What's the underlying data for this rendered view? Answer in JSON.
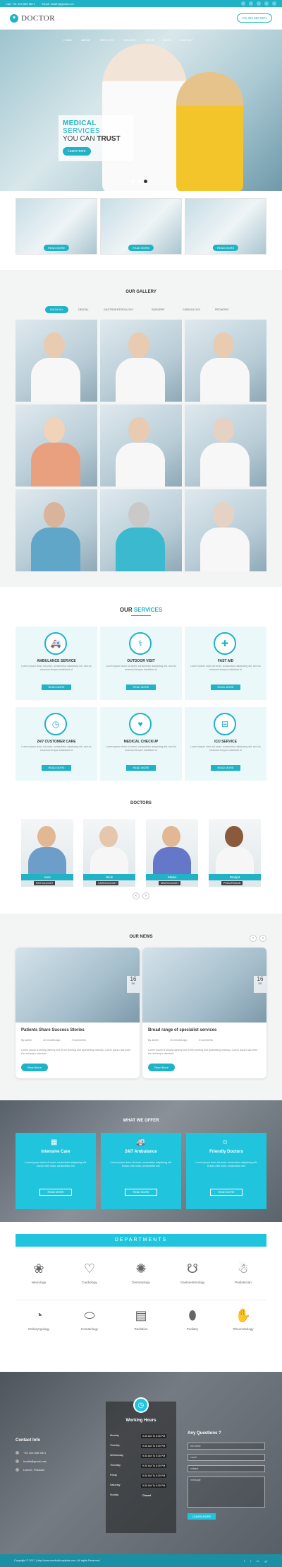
{
  "topbar": {
    "phone": "Call: +91 324 555 9871",
    "email": "Email: health@gmail.com",
    "social": [
      "f",
      "t",
      "in",
      "g+",
      "p"
    ]
  },
  "header": {
    "logo": "DOCTOR",
    "phone_button": "+91 324 556 9871",
    "nav": [
      "HOME",
      "ABOUT",
      "SERVICES",
      "GALLERY",
      "NEWS",
      "BLOG",
      "CONTACT"
    ]
  },
  "hero": {
    "line1_bold": "MEDICAL",
    "line1_thin": "SERVICES",
    "line2": "YOU CAN",
    "line2_bold": "TRUST",
    "button": "Learn more"
  },
  "features": [
    "READ MORE",
    "READ MORE",
    "READ MORE"
  ],
  "gallery": {
    "title": "OUR GALLERY",
    "filters": [
      "SHOW ALL",
      "DENTAL",
      "GASTROENTEROLOGY",
      "SURGERY",
      "CARDIOLOGY",
      "PEDIATRIC"
    ]
  },
  "services": {
    "title_a": "OUR",
    "title_b": "SERVICES",
    "items": [
      {
        "icon": "ambulance-icon",
        "glyph": "🚑",
        "title": "AMBULANCE SERVICE",
        "text": "Lorem ipsum dolor sit amet, consectetur adipiscing elit, sed do eiusmod tempor incididunt ut",
        "button": "READ MORE"
      },
      {
        "icon": "stethoscope-icon",
        "glyph": "⚕",
        "title": "OUTDOOR VISIT",
        "text": "Lorem ipsum dolor sit amet, consectetur adipiscing elit, sed do eiusmod tempor incididunt ut",
        "button": "READ MORE"
      },
      {
        "icon": "first-aid-icon",
        "glyph": "✚",
        "title": "FAST AID",
        "text": "Lorem ipsum dolor sit amet, consectetur adipiscing elit, sed do eiusmod tempor incididunt ut",
        "button": "READ MORE"
      },
      {
        "icon": "clock-icon",
        "glyph": "◷",
        "title": "24/7 CUSTOMER CARE",
        "text": "Lorem ipsum dolor sit amet, consectetur adipiscing elit, sed do eiusmod tempor incididunt ut",
        "button": "READ MORE"
      },
      {
        "icon": "heartbeat-icon",
        "glyph": "♥",
        "title": "MEDICAL CHECKUP",
        "text": "Lorem ipsum dolor sit amet, consectetur adipiscing elit, sed do eiusmod tempor incididunt ut",
        "button": "READ MORE"
      },
      {
        "icon": "bed-icon",
        "glyph": "⊟",
        "title": "ICU SERVICE",
        "text": "Lorem ipsum dolor sit amet, consectetur adipiscing elit, sed do eiusmod tempor incididunt ut",
        "button": "READ MORE"
      }
    ]
  },
  "doctors": {
    "title": "DOCTORS",
    "items": [
      {
        "name": "Joes",
        "role": "PATHOLOGIST"
      },
      {
        "name": "Wiok",
        "role": "CARDIOLOGIST"
      },
      {
        "name": "Starks",
        "role": "NEUROLOGIST"
      },
      {
        "name": "Bradpit",
        "role": "PEDIATRICIAN"
      }
    ],
    "prev": "‹",
    "next": "›"
  },
  "news": {
    "title": "OUR NEWS",
    "prev": "‹",
    "next": "›",
    "items": [
      {
        "day": "16",
        "month": "JUL",
        "title": "Patients Share Success Stories",
        "author": "By admin",
        "time": "10 minutes ago",
        "comments": "4 Comments",
        "text": "Lorem ipsum is simply dummy text of the printing and typesetting industry. Lorem Ipsum has been the industry's standard",
        "button": "Read More"
      },
      {
        "day": "16",
        "month": "JUL",
        "title": "Broad range of specialist services",
        "author": "By admin",
        "time": "10 minutes ago",
        "comments": "4 Comments",
        "text": "Lorem ipsum is simply dummy text of the printing and typesetting industry. Lorem Ipsum has been the industry's standard",
        "button": "Read More"
      }
    ]
  },
  "offer": {
    "title": "WHAT WE OFFER",
    "items": [
      {
        "icon": "hospital-icon",
        "glyph": "▦",
        "title": "Intensive Care",
        "text": "Lorem ipsum dolor sit amet, consectetur adipiscing elit. Donec nibh nulla, consectetur nec",
        "button": "READ MORE"
      },
      {
        "icon": "ambulance-icon",
        "glyph": "🚑",
        "title": "24/7 Ambulance",
        "text": "Lorem ipsum dolor sit amet, consectetur adipiscing elit. Donec nibh nulla, consectetur nec",
        "button": "READ MORE"
      },
      {
        "icon": "smile-icon",
        "glyph": "☺",
        "title": "Friendly Doctors",
        "text": "Lorem ipsum dolor sit amet, consectetur adipiscing elit. Donec nibh nulla, consectetur nec",
        "button": "READ MORE"
      }
    ]
  },
  "departments": {
    "title": "DEPARTMENTS",
    "items": [
      {
        "icon": "brain-icon",
        "glyph": "❀",
        "label": "Neurology"
      },
      {
        "icon": "heart-icon",
        "glyph": "♡",
        "label": "Cardiology"
      },
      {
        "icon": "skin-icon",
        "glyph": "✺",
        "label": "Dermatology"
      },
      {
        "icon": "stomach-icon",
        "glyph": "☋",
        "label": "Gastroenterology"
      },
      {
        "icon": "children-icon",
        "glyph": "☃",
        "label": "Pediatrician"
      },
      {
        "icon": "ear-icon",
        "glyph": "◔",
        "label": "Otolaryngology"
      },
      {
        "icon": "drop-icon",
        "glyph": "⬭",
        "label": "Hematology"
      },
      {
        "icon": "xray-icon",
        "glyph": "▤",
        "label": "Radiation"
      },
      {
        "icon": "foot-icon",
        "glyph": "⬮",
        "label": "Podiatry"
      },
      {
        "icon": "joint-icon",
        "glyph": "✋",
        "label": "Rheumatology"
      }
    ]
  },
  "footer": {
    "contact_title": "Contact Info",
    "contact_items": [
      "+91 324 556 9871",
      "health@gmail.com",
      "Lahore, Pakistan"
    ],
    "hours_title": "Working Hours",
    "hours": [
      {
        "day": "Monday",
        "time": "9:30 AM To 5:30 PM"
      },
      {
        "day": "Tuesday",
        "time": "9:30 AM To 5:30 PM"
      },
      {
        "day": "Wednesday",
        "time": "9:30 AM To 5:30 PM"
      },
      {
        "day": "Thursday",
        "time": "9:30 AM To 5:30 PM"
      },
      {
        "day": "Friday",
        "time": "9:30 AM To 5:30 PM"
      },
      {
        "day": "Saturday",
        "time": "9:30 AM To 5:30 PM"
      },
      {
        "day": "Sunday",
        "time": "Closed"
      }
    ],
    "questions_title": "Any Questions ?",
    "fields": [
      "full name",
      "email",
      "subject",
      "message"
    ],
    "send": "LEARN MORE",
    "copyright": "Copyright © 2017 | http://www.medicalhospitals.com. All rights Reserved.",
    "social": [
      "f",
      "t",
      "in",
      "g+"
    ]
  },
  "colors": {
    "accent": "#20b2c6",
    "accent_light": "#20c5dd"
  }
}
